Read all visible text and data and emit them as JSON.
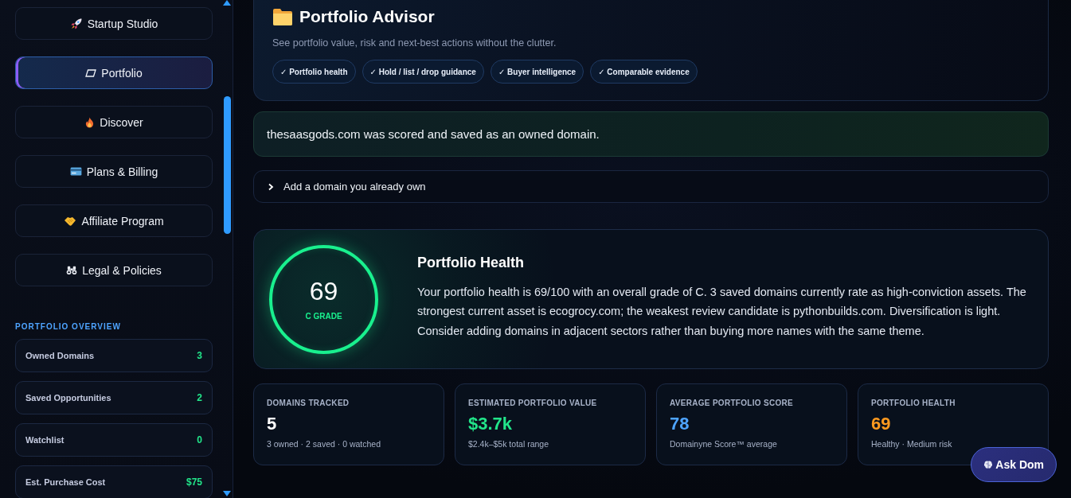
{
  "sidebar": {
    "nav_items": [
      {
        "label": "Startup Studio",
        "selected": false
      },
      {
        "label": "Portfolio",
        "selected": true
      },
      {
        "label": "Discover",
        "selected": false
      },
      {
        "label": "Plans & Billing",
        "selected": false
      },
      {
        "label": "Affiliate Program",
        "selected": false
      },
      {
        "label": "Legal & Policies",
        "selected": false
      }
    ],
    "overview": {
      "heading": "PORTFOLIO OVERVIEW",
      "rows": [
        {
          "label": "Owned Domains",
          "value": "3"
        },
        {
          "label": "Saved Opportunities",
          "value": "2"
        },
        {
          "label": "Watchlist",
          "value": "0"
        },
        {
          "label": "Est. Purchase Cost",
          "value": "$75"
        }
      ]
    }
  },
  "header": {
    "title": "Portfolio Advisor",
    "subtitle": "See portfolio value, risk and next-best actions without the clutter.",
    "chips": [
      "✓ Portfolio health",
      "✓ Hold / list / drop guidance",
      "✓ Buyer intelligence",
      "✓ Comparable evidence"
    ]
  },
  "alert": {
    "message": "thesaasgods.com was scored and saved as an owned domain."
  },
  "expander": {
    "label": "Add a domain you already own",
    "expanded": false
  },
  "health": {
    "score": "69",
    "grade": "C GRADE",
    "title": "Portfolio Health",
    "summary": "Your portfolio health is 69/100 with an overall grade of C. 3 saved domains currently rate as high-conviction assets. The strongest current asset is ecogrocy.com; the weakest review candidate is pythonbuilds.com. Diversification is light. Consider adding domains in adjacent sectors rather than buying more names with the same theme."
  },
  "stats": [
    {
      "label": "DOMAINS TRACKED",
      "value": "5",
      "color": "#ffffff",
      "note": "3 owned · 2 saved · 0 watched"
    },
    {
      "label": "ESTIMATED PORTFOLIO VALUE",
      "value": "$3.7k",
      "color": "#22e58a",
      "note": "$2.4k–$5k total range"
    },
    {
      "label": "AVERAGE PORTFOLIO SCORE",
      "value": "78",
      "color": "#4ea4ff",
      "note": "Domainyne Score™ average"
    },
    {
      "label": "PORTFOLIO HEALTH",
      "value": "69",
      "color": "#ff9a1f",
      "note": "Healthy · Medium risk"
    }
  ],
  "ask_button": {
    "label": "Ask Dom"
  }
}
